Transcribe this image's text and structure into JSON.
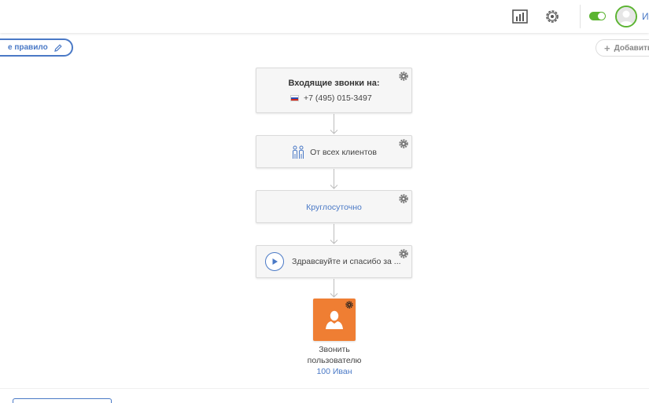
{
  "header": {
    "user_name": "И",
    "icons": [
      "stats-icon",
      "settings-icon",
      "status-toggle",
      "user-avatar-icon"
    ]
  },
  "toolbar": {
    "rule_name": "е правило",
    "add_label": "Добавить"
  },
  "flow": {
    "incoming": {
      "title": "Входящие звонки на:",
      "phone": "+7 (495) 015-3497"
    },
    "clients": {
      "label": "От всех клиентов"
    },
    "schedule": {
      "label": "Круглосуточно"
    },
    "greeting": {
      "label": "Здравсвуйте и спасибо за ..."
    },
    "call_user": {
      "label_line1": "Звонить",
      "label_line2": "пользователю",
      "user_link": "100 Иван"
    }
  },
  "colors": {
    "accent": "#4a79c6",
    "toggle_on": "#5bb431",
    "user_node": "#ef7e33",
    "node_bg": "#f6f6f6"
  }
}
